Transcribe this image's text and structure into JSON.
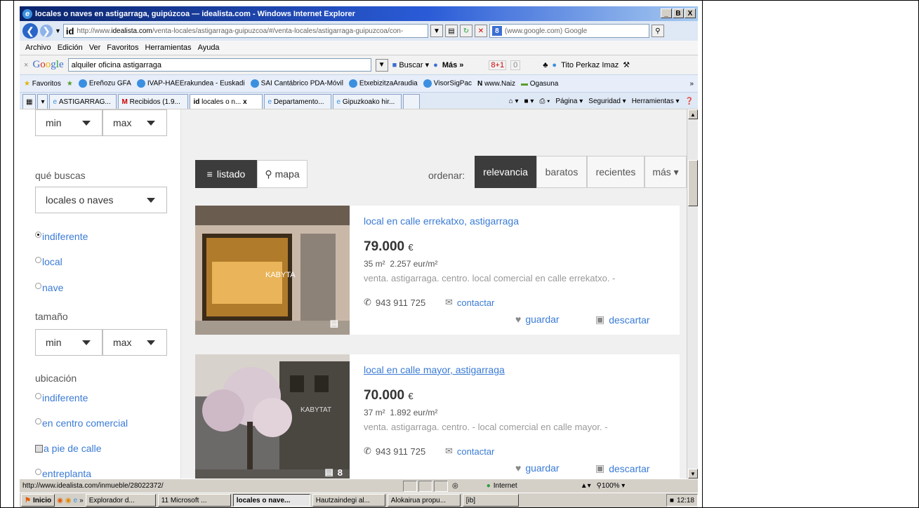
{
  "window": {
    "title": "locales o naves en astigarraga, guipúzcoa — idealista.com - Windows Internet Explorer",
    "buttons": [
      "_",
      "B",
      "X"
    ]
  },
  "address": {
    "site_logo": "id",
    "url_prefix": "http://www.",
    "url_host": "idealista.com",
    "url_rest": "/venta-locales/astigarraga-guipuzcoa/#/venta-locales/astigarraga-guipuzcoa/con-",
    "search_placeholder": "(www.google.com) Google"
  },
  "menu": [
    "Archivo",
    "Edición",
    "Ver",
    "Favoritos",
    "Herramientas",
    "Ayuda"
  ],
  "google_bar": {
    "close": "×",
    "query": "alquiler oficina astigarraga",
    "search_button": "Buscar",
    "more": "Más »",
    "plus_one": "8+1",
    "plus_count": "0",
    "user": "Tito Perkaz Imaz"
  },
  "favorites": {
    "label": "Favoritos",
    "items": [
      "Ereñozu GFA",
      "IVAP-HAEErakundea - Euskadi",
      "SAI Cantábrico PDA-Móvil",
      "EtxebizitzaAraudia",
      "VisorSigPac",
      "www.Naiz",
      "Ogasuna"
    ],
    "overflow": "»"
  },
  "tabs": [
    {
      "label": "ASTIGARRAG...",
      "active": false
    },
    {
      "label": "Recibidos (1.9...",
      "active": false
    },
    {
      "label": "locales o n...",
      "active": true
    },
    {
      "label": "Departamento...",
      "active": false
    },
    {
      "label": "Gipuzkoako hir...",
      "active": false
    }
  ],
  "tab_close": "x",
  "tab_tools": [
    "Página",
    "Seguridad",
    "Herramientas"
  ],
  "sidebar": {
    "price_min": "min",
    "price_max": "max",
    "what_label": "qué buscas",
    "what_value": "locales o naves",
    "type_options": [
      {
        "label": "indiferente",
        "selected": true
      },
      {
        "label": "local",
        "selected": false
      },
      {
        "label": "nave",
        "selected": false
      }
    ],
    "size_label": "tamaño",
    "size_min": "min",
    "size_max": "max",
    "location_label": "ubicación",
    "location_options": [
      {
        "label": "indiferente",
        "kind": "radio"
      },
      {
        "label": "en centro comercial",
        "kind": "radio"
      },
      {
        "label": "a pie de calle",
        "kind": "check"
      },
      {
        "label": "entreplanta",
        "kind": "radio"
      }
    ]
  },
  "view": {
    "list_label": "listado",
    "map_label": "mapa",
    "sort_label": "ordenar:",
    "sort_options": [
      "relevancia",
      "baratos",
      "recientes",
      "más"
    ],
    "active_sort": "relevancia"
  },
  "listings": [
    {
      "title": "local en calle errekatxo, astigarraga",
      "price": "79.000",
      "currency": "€",
      "area": "35 m²",
      "price_per_m2": "2.257 eur/m²",
      "description": "venta. astigarraga. centro. local comercial en calle errekatxo. -",
      "phone": "943 911 725",
      "contact": "contactar",
      "save": "guardar",
      "discard": "descartar",
      "photo_count": "",
      "sign_text": "KABYTA"
    },
    {
      "title": "local en calle mayor, astigarraga",
      "price": "70.000",
      "currency": "€",
      "area": "37 m²",
      "price_per_m2": "1.892 eur/m²",
      "description": "venta. astigarraga. centro. - local comercial en calle mayor. -",
      "phone": "943 911 725",
      "contact": "contactar",
      "save": "guardar",
      "discard": "descartar",
      "photo_count": "8",
      "sign_text": "KABYTAT"
    }
  ],
  "status": {
    "url": "http://www.idealista.com/inmueble/28022372/",
    "zone": "Internet",
    "zoom": "100%"
  },
  "taskbar": {
    "start": "Inicio",
    "items": [
      "Explorador d...",
      "11 Microsoft ...",
      "locales o nave...",
      "Hautzaindegi al...",
      "Alokairua propu...",
      "[ib]"
    ],
    "active_index": 2,
    "clock": "12:18"
  }
}
